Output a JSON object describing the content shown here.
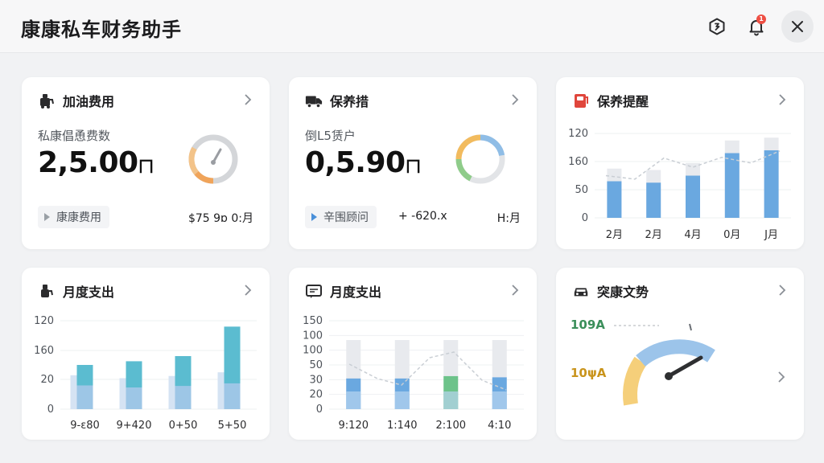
{
  "app": {
    "title": "康康私车财务助手"
  },
  "header": {
    "notification_count": "1"
  },
  "cards": {
    "fuel": {
      "title": "加油费用",
      "subtitle": "私康倡恿费数",
      "amount": "2,5.00",
      "amount_unit": "ㄇ",
      "tag": "康康费用",
      "footer": "$75 9ɒ 0:月",
      "donut_fraction": 0.72,
      "colors": {
        "ring": "#cfd1d4",
        "accent": "#f0a45a"
      }
    },
    "maintenance": {
      "title": "保养措",
      "subtitle": "倒L5赁户",
      "amount": "0,5.90",
      "amount_unit": "ㄇ",
      "tag": "辛围顾问",
      "delta": "+ -620.x",
      "footer": "H:月",
      "colors": {
        "blue": "#8fbde6",
        "orange": "#f2bb5e",
        "green": "#8fcc8a",
        "gray": "#e2e4e7"
      }
    },
    "reminder": {
      "title": "保养提醒",
      "chart_data": {
        "type": "bar",
        "categories": [
          "2月",
          "2月",
          "4月",
          "0月",
          "J月"
        ],
        "yticks": [
          "120",
          "160",
          "50",
          "0"
        ],
        "values": [
          52,
          50,
          60,
          92,
          96
        ],
        "ylim": [
          0,
          120
        ],
        "line": [
          60,
          55,
          85,
          72,
          86,
          78,
          95
        ],
        "colors": {
          "bar": "#6aa8e0",
          "bg": "#e8eaee"
        }
      }
    },
    "monthly1": {
      "title": "月度支出",
      "chart_data": {
        "type": "bar",
        "categories": [
          "9-ɛ80",
          "9+420",
          "0+50",
          "5+50"
        ],
        "yticks": [
          "120",
          "160",
          "20",
          "0"
        ],
        "series": [
          {
            "values": [
              60,
              65,
              72,
              112
            ]
          },
          {
            "values": [
              46,
              42,
              45,
              50
            ]
          }
        ],
        "ylim": [
          0,
          120
        ],
        "colors": {
          "front": "#5bbcd0",
          "back": "#a9c8ea"
        }
      }
    },
    "monthly2": {
      "title": "月度支出",
      "chart_data": {
        "type": "bar",
        "categories": [
          "9:120",
          "1:140",
          "2:100",
          "4:10"
        ],
        "yticks": [
          "150",
          "100",
          "100",
          "50",
          "30",
          "20",
          "0"
        ],
        "values": [
          52,
          52,
          56,
          54
        ],
        "highlight_index": 2,
        "ylim": [
          0,
          150
        ],
        "colors": {
          "bar": "#6aa8e0",
          "highlight": "#6dc38a",
          "bg": "#e8eaee",
          "base": "#b8d4f0"
        }
      }
    },
    "safety": {
      "title": "突康文势",
      "label_top": "109A",
      "label_bottom": "10ψA",
      "gauge_fraction": 0.72,
      "colors": {
        "green": "#3b8f5a",
        "orange": "#c9941c",
        "arc_blue": "#9cc4ea",
        "arc_orange": "#f5cf7a"
      }
    }
  }
}
